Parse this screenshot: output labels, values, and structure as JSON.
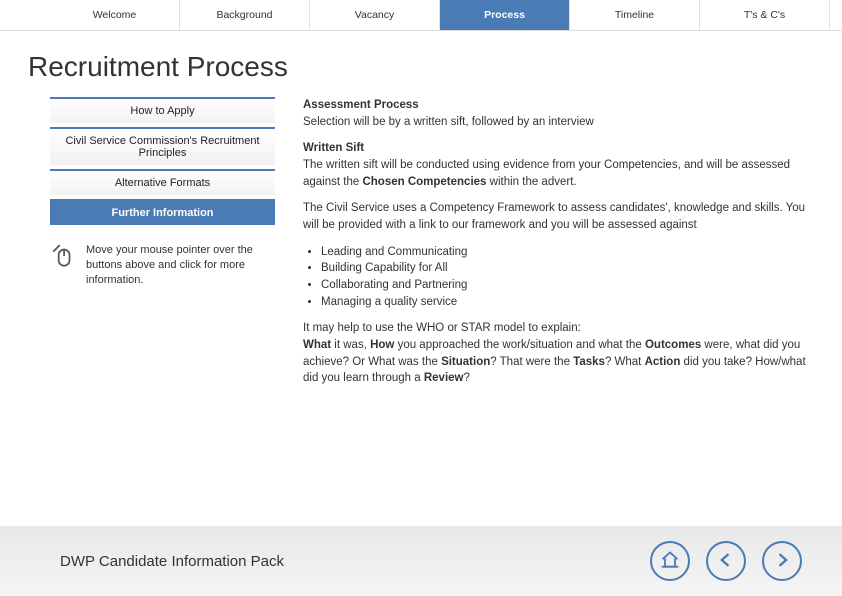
{
  "nav": {
    "tabs": [
      {
        "label": "Welcome"
      },
      {
        "label": "Background"
      },
      {
        "label": "Vacancy"
      },
      {
        "label": "Process"
      },
      {
        "label": "Timeline"
      },
      {
        "label": "T's & C's"
      }
    ],
    "active_index": 3
  },
  "page_title": "Recruitment Process",
  "sidebar": {
    "items": [
      {
        "label": "How to Apply"
      },
      {
        "label": "Civil Service Commission's Recruitment Principles"
      },
      {
        "label": "Alternative Formats"
      },
      {
        "label": "Further Information"
      }
    ],
    "active_index": 3,
    "hint": "Move your mouse pointer over the buttons above and click for more information."
  },
  "main": {
    "assessment_heading": "Assessment Process",
    "assessment_body": "Selection will be by a written sift, followed by an interview",
    "sift_heading": "Written Sift",
    "sift_body_pre": "The written sift will be conducted using evidence from your Competencies, and will be assessed against the ",
    "sift_bold": "Chosen Competencies",
    "sift_body_post": " within the advert.",
    "framework": "The Civil Service uses a Competency Framework to assess candidates', knowledge and skills. You will be provided with a link to our framework and you will be assessed against",
    "competencies": [
      "Leading and Communicating",
      "Building Capability for All",
      "Collaborating and Partnering",
      "Managing a quality service"
    ],
    "who_intro": "It may help to use the WHO or STAR model to explain:",
    "who_line1_w1": "What",
    "who_line1_t1": " it was, ",
    "who_line1_w2": "How",
    "who_line1_t2": " you approached the work/situation and what the ",
    "who_line1_w3": "Outcomes",
    "who_line1_t3": " were, what did you achieve? Or What was the ",
    "who_line1_w4": "Situation",
    "who_line1_t4": "? That were the ",
    "who_line1_w5": "Tasks",
    "who_line1_t5": "? What ",
    "who_line1_w6": "Action",
    "who_line1_t6": " did you take? How/what did you learn through a ",
    "who_line1_w7": "Review",
    "who_line1_t7": "?"
  },
  "footer": {
    "title": "DWP Candidate Information Pack"
  }
}
